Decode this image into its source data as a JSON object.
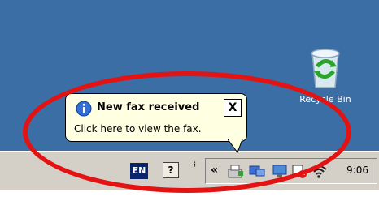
{
  "desktop": {
    "icons": [
      {
        "label": "Recycle Bin",
        "icon": "recycle-bin-icon"
      }
    ]
  },
  "taskbar": {
    "language": "EN",
    "help_glyph": "?",
    "grip_glyph": "⁝",
    "tray_chevron": "«",
    "tray_icons": [
      "fax-icon",
      "network-icon",
      "monitor-icon",
      "volume-icon",
      "wifi-icon"
    ],
    "clock": "9:06"
  },
  "balloon": {
    "title": "New fax received",
    "message": "Click here to view the fax.",
    "close_glyph": "X",
    "icon": "info-icon"
  },
  "colors": {
    "desktop": "#3a6ea5",
    "taskbar": "#d4d0c8",
    "balloon": "#ffffe1",
    "highlight_ring": "#e41313"
  }
}
